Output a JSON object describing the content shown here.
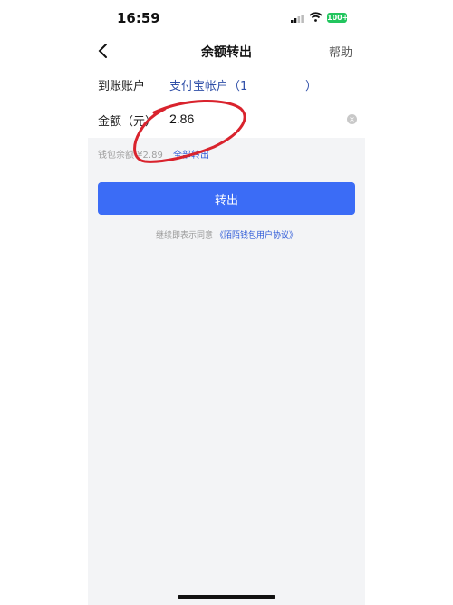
{
  "status_bar": {
    "time": "16:59",
    "battery": "100+",
    "icons": [
      "signal-icon",
      "wifi-icon",
      "battery-icon"
    ]
  },
  "nav": {
    "title": "余额转出",
    "help_label": "帮助",
    "back_icon": "chevron-left-icon"
  },
  "form": {
    "account_label": "到账账户",
    "account_value": "支付宝帐户（1",
    "account_close": "）",
    "amount_label": "金额（元）",
    "amount_value": "2.86",
    "clear_icon": "clear-circle-icon"
  },
  "balance": {
    "text": "钱包余额 ¥2.89",
    "transfer_all_label": "全部转出"
  },
  "submit": {
    "label": "转出"
  },
  "agreement": {
    "prefix": "继续即表示同意",
    "link": "《陌陌钱包用户协议》"
  },
  "colors": {
    "primary_button": "#3b6cf6",
    "link": "#2f5bd8",
    "annotation": "#d9232d",
    "page_background": "#f3f4f6"
  }
}
